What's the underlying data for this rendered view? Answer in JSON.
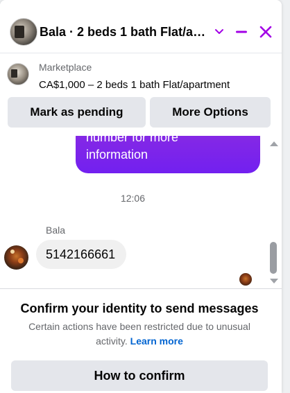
{
  "header": {
    "title": "Bala · 2 beds 1 bath Flat/a…",
    "accent_color": "#a200e6"
  },
  "listing": {
    "source": "Marketplace",
    "price_title": "CA$1,000 – 2 beds 1 bath Flat/apartment",
    "mark_pending_label": "Mark as pending",
    "more_options_label": "More Options"
  },
  "messages": {
    "outgoing_line1": "number for more",
    "outgoing_line2": "information",
    "timestamp": "12:06",
    "sender_name": "Bala",
    "incoming_text": "5142166661",
    "outgoing_color": "#7b22e8"
  },
  "notice": {
    "title": "Confirm your identity to send messages",
    "body": "Certain actions have been restricted due to unusual activity.",
    "link": "Learn more",
    "button_label": "How to confirm"
  }
}
